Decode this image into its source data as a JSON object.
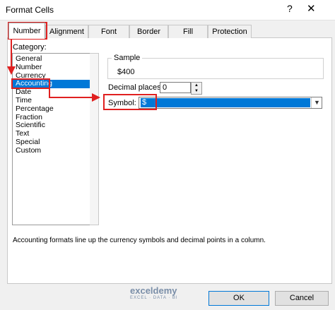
{
  "window": {
    "title": "Format Cells",
    "help_glyph": "?",
    "close_glyph": "✕"
  },
  "tabs": [
    {
      "label": "Number"
    },
    {
      "label": "Alignment"
    },
    {
      "label": "Font"
    },
    {
      "label": "Border"
    },
    {
      "label": "Fill"
    },
    {
      "label": "Protection"
    }
  ],
  "category": {
    "label": "Category:",
    "items": [
      "General",
      "Number",
      "Currency",
      "Accounting",
      "Date",
      "Time",
      "Percentage",
      "Fraction",
      "Scientific",
      "Text",
      "Special",
      "Custom"
    ],
    "selected": "Accounting"
  },
  "sample": {
    "label": "Sample",
    "value": "$400"
  },
  "decimal_places": {
    "label": "Decimal places:",
    "value": "0"
  },
  "symbol": {
    "label": "Symbol:",
    "value": "$"
  },
  "description": "Accounting formats line up the currency symbols and decimal points in a column.",
  "buttons": {
    "ok": "OK",
    "cancel": "Cancel"
  },
  "watermark": {
    "name": "exceldemy",
    "tagline": "EXCEL · DATA · BI"
  },
  "colors": {
    "selection": "#0078d7",
    "annotation": "#e02020"
  }
}
